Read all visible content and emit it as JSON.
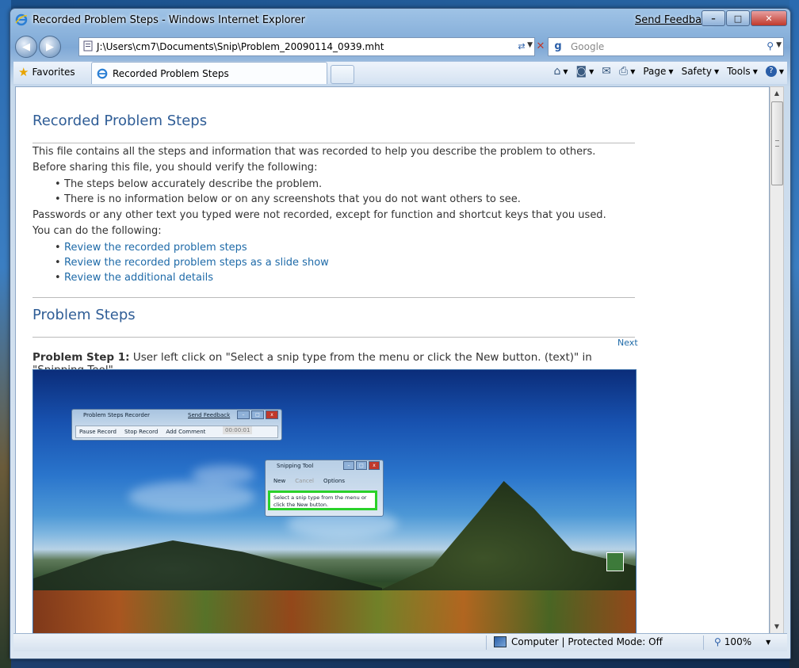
{
  "window": {
    "title": "Recorded Problem Steps - Windows Internet Explorer",
    "feedback_link": "Send Feedback",
    "buttons": {
      "minimize": "–",
      "maximize": "□",
      "close": "✕"
    }
  },
  "nav": {
    "back": "◀",
    "forward": "▶",
    "address": "J:\\Users\\cm7\\Documents\\Snip\\Problem_20090114_0939.mht",
    "search_placeholder": "Google"
  },
  "commandbar": {
    "favorites_label": "Favorites",
    "tab_label": "Recorded Problem Steps",
    "page_label": "Page",
    "safety_label": "Safety",
    "tools_label": "Tools"
  },
  "page": {
    "heading": "Recorded Problem Steps",
    "intro_line1": "This file contains all the steps and information that was recorded to help you describe the problem to others.",
    "intro_line2": "Before sharing this file, you should verify the following:",
    "verify_items": [
      "The steps below accurately describe the problem.",
      "There is no information below or on any screenshots that you do not want others to see."
    ],
    "passwords_note": "Passwords or any other text you typed were not recorded, except for function and shortcut keys that you used.",
    "you_can": "You can do the following:",
    "links": [
      "Review the recorded problem steps",
      "Review the recorded problem steps as a slide show",
      "Review the additional details"
    ],
    "steps_heading": "Problem Steps",
    "next_label": "Next",
    "step1_prefix": "Problem Step 1:",
    "step1_text": " User left click on \"Select a snip type from the menu or click the New button. (text)\" in \"Snipping Tool\""
  },
  "screenshot": {
    "psr_title": "Problem Steps Recorder",
    "psr_feedback": "Send Feedback",
    "psr_pause": "Pause Record",
    "psr_stop": "Stop Record",
    "psr_comment": "Add Comment",
    "psr_time": "00:00:01",
    "snip_title": "Snipping Tool",
    "snip_new": "New",
    "snip_cancel": "Cancel",
    "snip_options": "Options",
    "snip_msg": "Select a snip type from the menu or click the New button."
  },
  "status": {
    "zone": "Computer | Protected Mode: Off",
    "zoom": "100%"
  },
  "colors": {
    "link": "#1e6aa8",
    "heading": "#2f5d96",
    "highlight": "#2ad12a"
  }
}
